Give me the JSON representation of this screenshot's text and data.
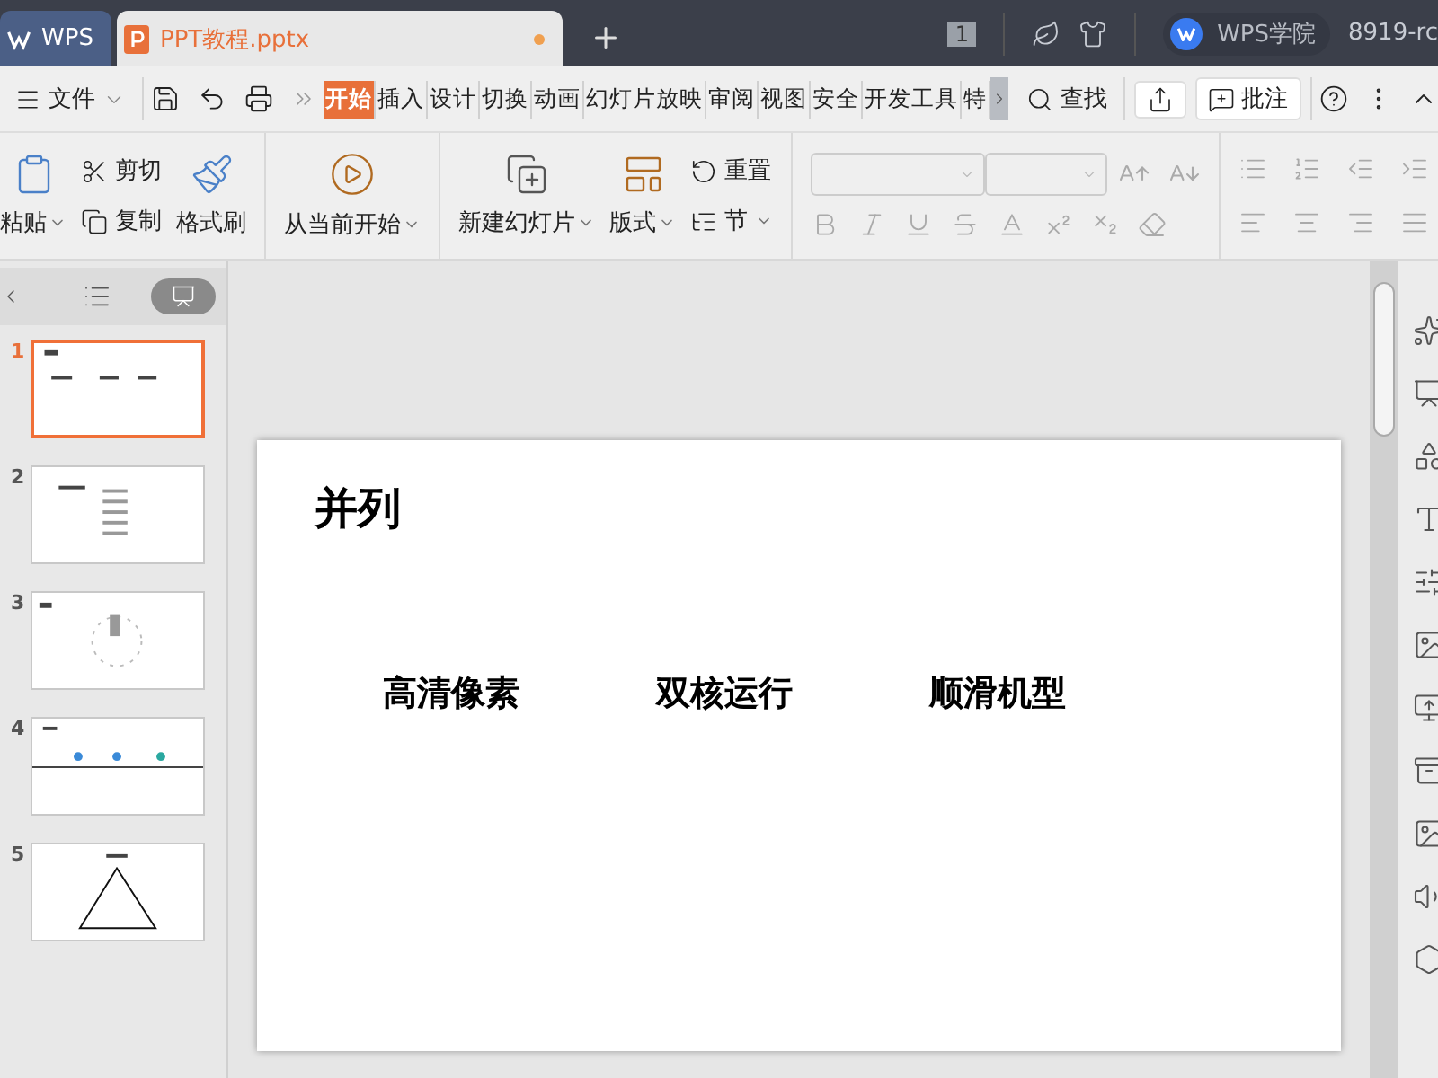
{
  "window_tabs": [
    {
      "kind": "home",
      "label": "WPS",
      "selected": false
    },
    {
      "kind": "document",
      "label": "PPT教程.pptx",
      "selected": true
    }
  ],
  "title_bar": {
    "badge": "1",
    "account": "WPS学院",
    "user": "8919-rc"
  },
  "file_menu": "文件",
  "menu_tabs": [
    {
      "label": "开始",
      "selected": true
    },
    {
      "label": "插入",
      "selected": false
    },
    {
      "label": "设计",
      "selected": false
    },
    {
      "label": "切换",
      "selected": false
    },
    {
      "label": "动画",
      "selected": false
    },
    {
      "label": "幻灯片放映",
      "selected": false
    },
    {
      "label": "审阅",
      "selected": false
    },
    {
      "label": "视图",
      "selected": false
    },
    {
      "label": "安全",
      "selected": false
    },
    {
      "label": "开发工具",
      "selected": false
    },
    {
      "label": "特",
      "selected": false
    }
  ],
  "find": "查找",
  "comment": "批注",
  "ribbon": {
    "paste": "粘贴",
    "cut": "剪切",
    "copy": "复制",
    "format_painter": "格式刷",
    "play": "从当前开始",
    "new_slide": "新建幻灯片",
    "layout": "版式",
    "reset": "重置",
    "section": "节"
  },
  "slides": [
    {
      "number": "1",
      "kind": "columns",
      "selected": true
    },
    {
      "number": "2",
      "kind": "list",
      "selected": false
    },
    {
      "number": "3",
      "kind": "cycle",
      "selected": false
    },
    {
      "number": "4",
      "kind": "timeline",
      "selected": false
    },
    {
      "number": "5",
      "kind": "pyramid",
      "selected": false
    }
  ],
  "slide": {
    "title": "并列",
    "items": [
      "高清像素",
      "双核运行",
      "顺滑机型"
    ]
  }
}
